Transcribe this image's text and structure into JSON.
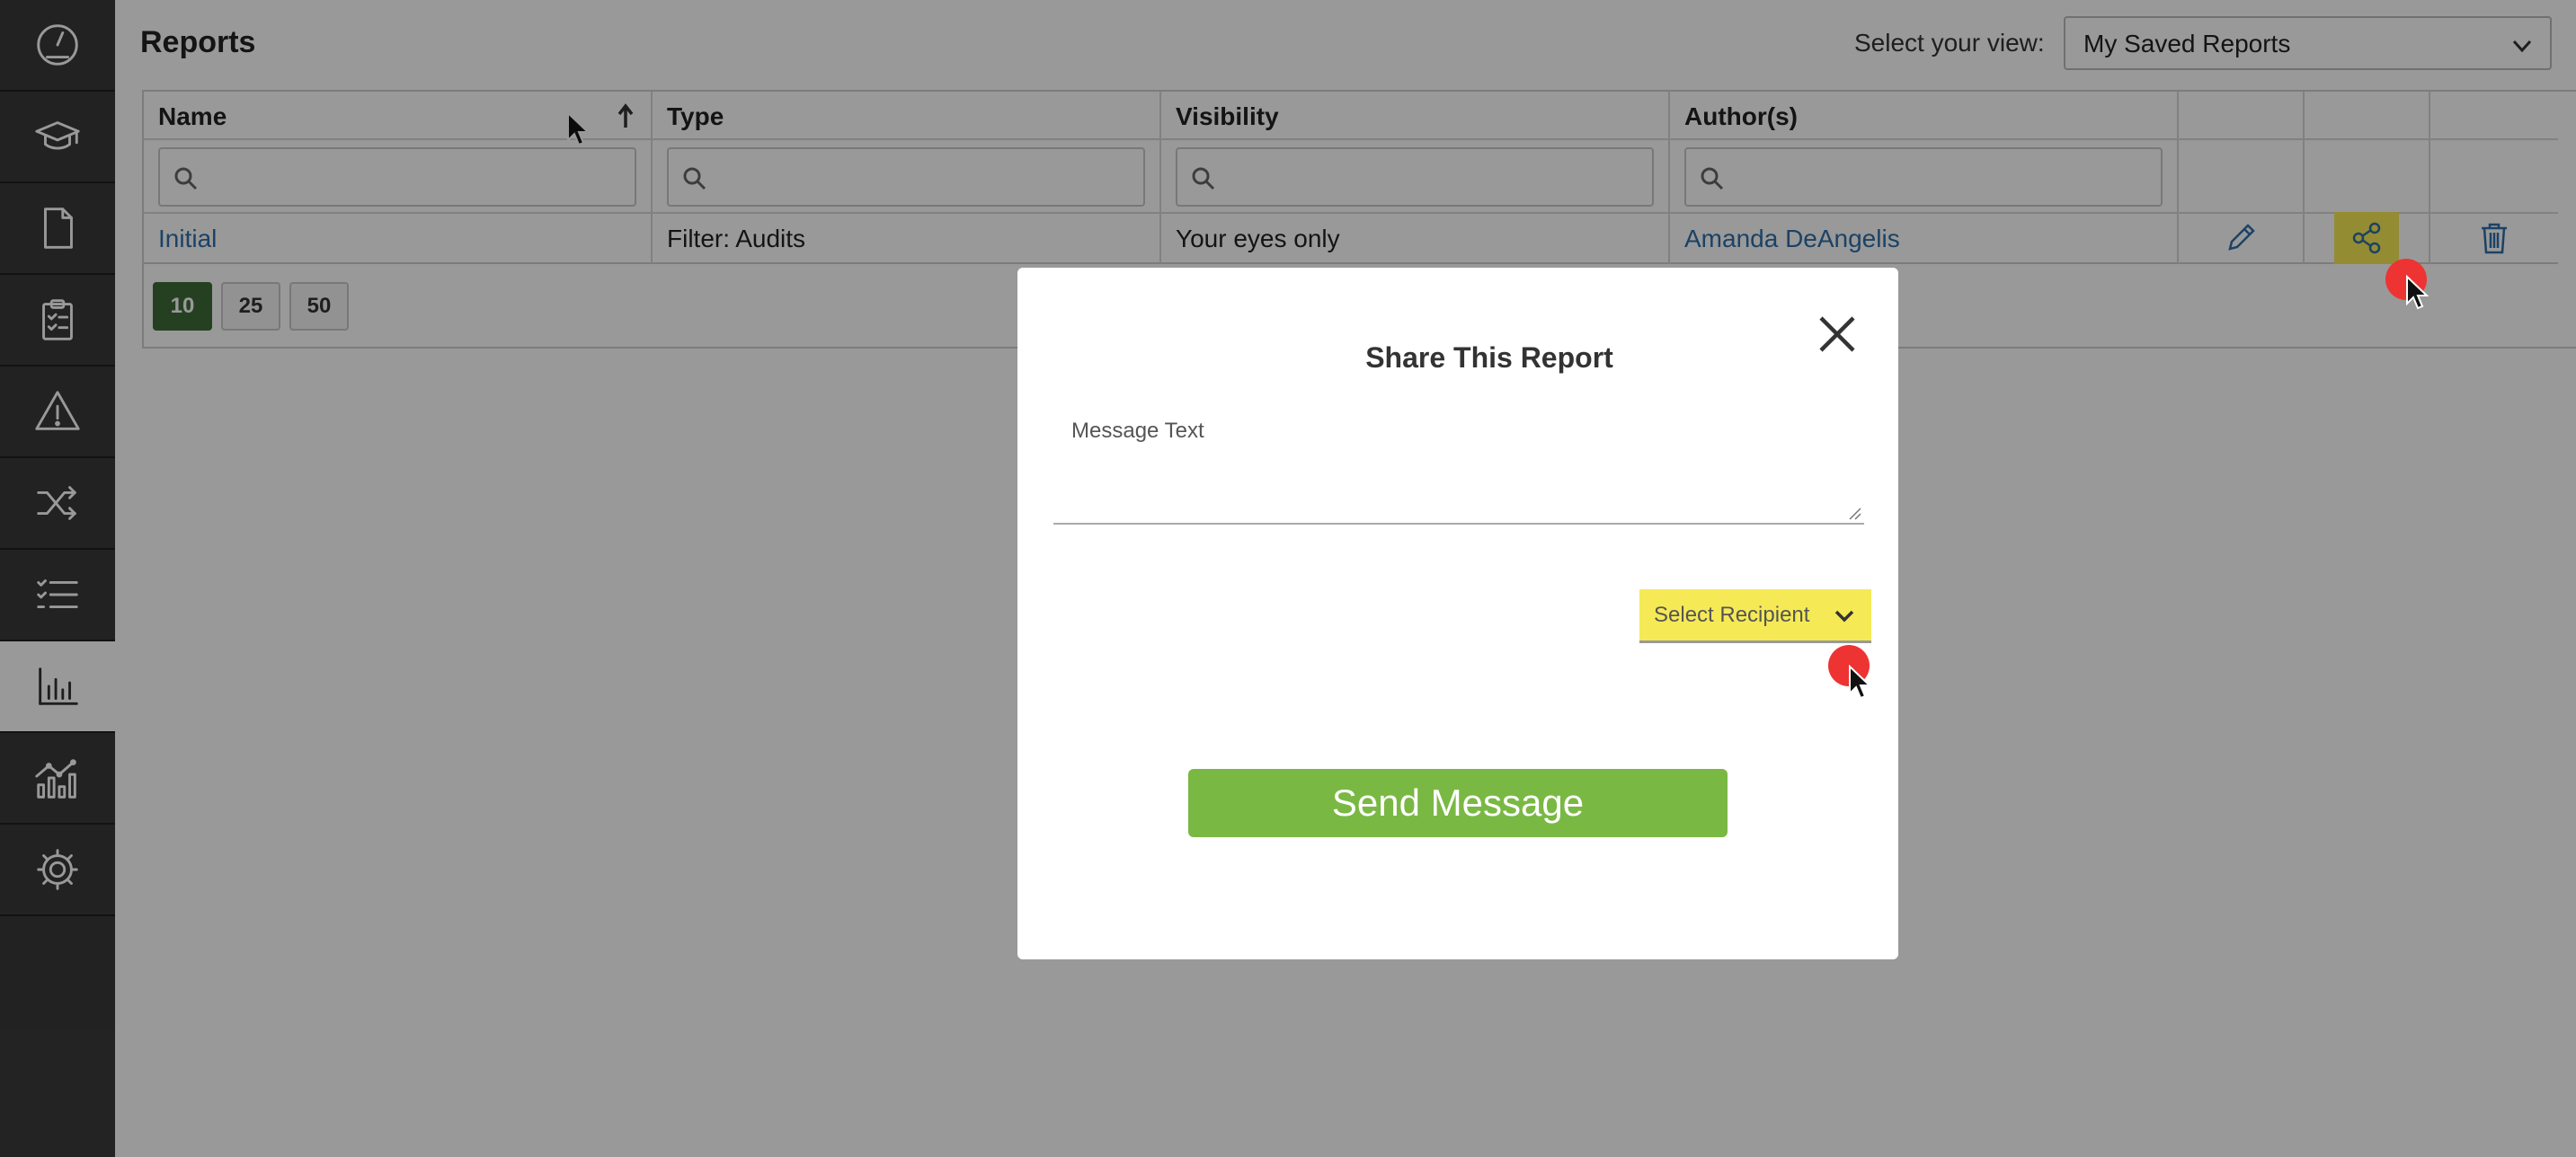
{
  "page": {
    "title": "Reports",
    "view_label": "Select your view:",
    "view_selected": "My Saved Reports"
  },
  "sidebar": {
    "items": [
      {
        "name": "dashboard-gauge-icon"
      },
      {
        "name": "training-cap-icon"
      },
      {
        "name": "document-icon"
      },
      {
        "name": "clipboard-checklist-icon"
      },
      {
        "name": "warning-icon"
      },
      {
        "name": "shuffle-icon"
      },
      {
        "name": "checklist-icon"
      },
      {
        "name": "bar-chart-icon",
        "active": true
      },
      {
        "name": "analytics-icon"
      },
      {
        "name": "settings-gear-icon"
      }
    ]
  },
  "table": {
    "columns": [
      "Name",
      "Type",
      "Visibility",
      "Author(s)"
    ],
    "rows": [
      {
        "name": "Initial",
        "type": "Filter: Audits",
        "visibility": "Your eyes only",
        "author": "Amanda DeAngelis"
      }
    ],
    "page_sizes": [
      "10",
      "25",
      "50"
    ],
    "selected_page_size": "10",
    "current_page": "1"
  },
  "modal": {
    "title": "Share This Report",
    "message_label": "Message Text",
    "recipient_placeholder": "Select Recipient",
    "send_label": "Send Message"
  },
  "colors": {
    "sidebar_bg": "#3a3a3a",
    "link": "#2f6ea8",
    "send_button": "#7ab844",
    "highlight": "#f5ea55",
    "pager_active": "#3d6b36"
  }
}
